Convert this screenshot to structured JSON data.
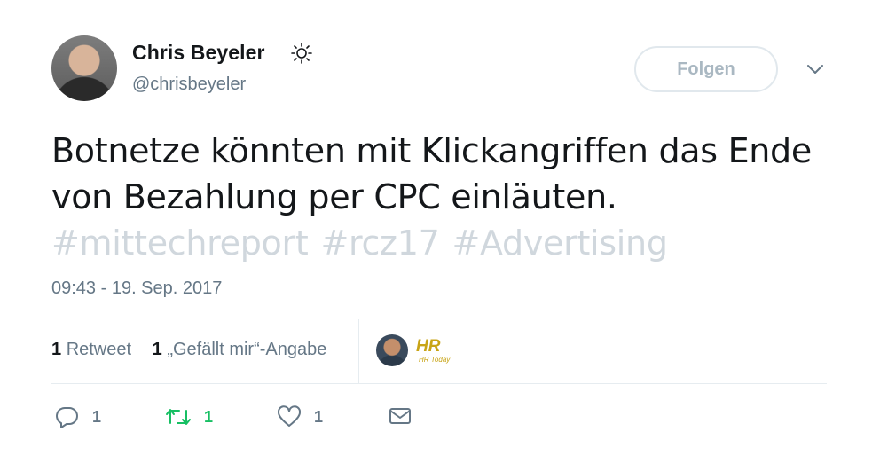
{
  "author": {
    "name": "Chris Beyeler",
    "handle": "@chrisbeyeler"
  },
  "follow_button": "Folgen",
  "tweet": {
    "line1": "Botnetze könnten mit Klickangriffen das Ende",
    "line2": "von Bezahlung per CPC einläuten.",
    "hashtags": [
      "#mittechreport",
      "#rcz17",
      "#Advertising"
    ]
  },
  "timestamp": "09:43 - 19. Sep. 2017",
  "stats": {
    "retweet_count": "1",
    "retweet_label": "Retweet",
    "like_count": "1",
    "like_label": "„Gefällt mir“-Angabe"
  },
  "liker_badge": "HR Today",
  "actions": {
    "reply_count": "1",
    "retweet_count": "1",
    "like_count": "1"
  },
  "colors": {
    "text": "#14171a",
    "muted": "#657786",
    "hashtag": "#d0d7dd",
    "retweet": "#17bf63",
    "border": "#e6ecf0"
  }
}
